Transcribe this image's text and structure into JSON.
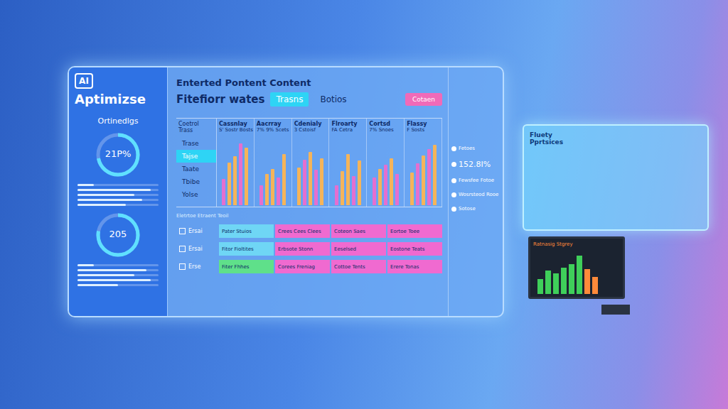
{
  "sidebar": {
    "logo": "AI",
    "title": "Aptimizse",
    "subtitle": "Ortinedlgs",
    "gauges": [
      {
        "reading": "21P%",
        "level": 0.72
      },
      {
        "reading": "205",
        "level": 0.78
      }
    ],
    "meters_top": [
      {
        "level": 0.2
      },
      {
        "level": 0.9
      },
      {
        "level": 0.7
      },
      {
        "level": 0.8
      },
      {
        "level": 0.6
      }
    ],
    "meters_bottom": [
      {
        "level": 0.2
      },
      {
        "level": 0.85
      },
      {
        "level": 0.7
      },
      {
        "level": 0.9
      },
      {
        "level": 0.5
      }
    ]
  },
  "header": {
    "title": "Enterted Pontent Content",
    "subtitle": "Fitefiorr wates",
    "tabs": [
      {
        "label": "Trasns",
        "selected": true
      },
      {
        "label": "Botios",
        "selected": false
      }
    ],
    "button": "Cotaen"
  },
  "chart": {
    "label_header": "Coetrol Trass",
    "row_labels": [
      {
        "label": "Trase",
        "selected": false
      },
      {
        "label": "Tajse",
        "selected": true
      },
      {
        "label": "Taate",
        "selected": false
      },
      {
        "label": "Tbibe",
        "selected": false
      },
      {
        "label": "Yolse",
        "selected": false
      }
    ],
    "groups": [
      {
        "label": "Cassnlay",
        "sub": "S' Sostr Bosts",
        "bars": [
          {
            "value": 40,
            "color": "#e46fd0"
          },
          {
            "value": 65,
            "color": "#f5b45a"
          },
          {
            "value": 75,
            "color": "#f5b45a"
          },
          {
            "value": 95,
            "color": "#e46fd0"
          },
          {
            "value": 88,
            "color": "#f5b45a"
          }
        ]
      },
      {
        "label": "Aacrray",
        "sub": "7% 9% Scets",
        "bars": [
          {
            "value": 30,
            "color": "#e46fd0"
          },
          {
            "value": 48,
            "color": "#f5b45a"
          },
          {
            "value": 55,
            "color": "#f5b45a"
          },
          {
            "value": 42,
            "color": "#e46fd0"
          },
          {
            "value": 78,
            "color": "#f5b45a"
          }
        ]
      },
      {
        "label": "Cdenialy",
        "sub": "3 Cstoisf",
        "bars": [
          {
            "value": 58,
            "color": "#f5b45a"
          },
          {
            "value": 70,
            "color": "#e46fd0"
          },
          {
            "value": 82,
            "color": "#f5b45a"
          },
          {
            "value": 54,
            "color": "#e46fd0"
          },
          {
            "value": 72,
            "color": "#f5b45a"
          }
        ]
      },
      {
        "label": "Flroarty",
        "sub": "FA Cetra",
        "bars": [
          {
            "value": 30,
            "color": "#e46fd0"
          },
          {
            "value": 52,
            "color": "#f5b45a"
          },
          {
            "value": 78,
            "color": "#f5b45a"
          },
          {
            "value": 45,
            "color": "#e46fd0"
          },
          {
            "value": 68,
            "color": "#f5b45a"
          }
        ]
      },
      {
        "label": "Cortsd",
        "sub": "7% Snoes",
        "bars": [
          {
            "value": 42,
            "color": "#e46fd0"
          },
          {
            "value": 55,
            "color": "#f5b45a"
          },
          {
            "value": 62,
            "color": "#e46fd0"
          },
          {
            "value": 72,
            "color": "#f5b45a"
          },
          {
            "value": 48,
            "color": "#e46fd0"
          }
        ]
      },
      {
        "label": "Flassy",
        "sub": "F Sosts",
        "bars": [
          {
            "value": 50,
            "color": "#f5b45a"
          },
          {
            "value": 64,
            "color": "#e46fd0"
          },
          {
            "value": 76,
            "color": "#f5b45a"
          },
          {
            "value": 86,
            "color": "#e46fd0"
          },
          {
            "value": 92,
            "color": "#f5b45a"
          }
        ]
      }
    ]
  },
  "table": {
    "header": "Eletrtoe Etraent Teoil",
    "rows": [
      {
        "label": "Ersai",
        "cells": [
          {
            "text": "Pater Stuios",
            "color": "#6fd6f5"
          },
          {
            "text": "Crees Cees Clees",
            "color": "#f06ad0"
          },
          {
            "text": "Coteon Saes",
            "color": "#f06ad0"
          },
          {
            "text": "Eortoe Toee",
            "color": "#f06ad0"
          }
        ]
      },
      {
        "label": "Ersai",
        "cells": [
          {
            "text": "Fitor Fioltites",
            "color": "#6fd6f5"
          },
          {
            "text": "Erbsote Stonn",
            "color": "#f06ad0"
          },
          {
            "text": "Eeselsed",
            "color": "#f06ad0"
          },
          {
            "text": "Eostone Teats",
            "color": "#f06ad0"
          }
        ]
      },
      {
        "label": "Erse",
        "cells": [
          {
            "text": "Fiter Fhhes",
            "color": "#5fe08a"
          },
          {
            "text": "Corees Freniag",
            "color": "#f06ad0"
          },
          {
            "text": "Cottoe Tents",
            "color": "#f06ad0"
          },
          {
            "text": "Erere Tonas",
            "color": "#f06ad0"
          }
        ]
      }
    ]
  },
  "right_list": [
    {
      "text": "Fetoes",
      "kind": "small"
    },
    {
      "text": "152.8I%",
      "kind": "big"
    },
    {
      "text": "Fewsfee Fotoe",
      "kind": "small"
    },
    {
      "text": "Wosrsteod Rooe",
      "kind": "small"
    },
    {
      "text": "Sotose",
      "kind": "small"
    }
  ],
  "holo_panel": {
    "title": "Fluety Pprtsices"
  },
  "monitor": {
    "title": "Ratnasig Stgrey",
    "bars": [
      {
        "value": 35,
        "color": "#3fcf5a"
      },
      {
        "value": 55,
        "color": "#3fcf5a"
      },
      {
        "value": 48,
        "color": "#3fcf5a"
      },
      {
        "value": 62,
        "color": "#3fcf5a"
      },
      {
        "value": 70,
        "color": "#3fcf5a"
      },
      {
        "value": 90,
        "color": "#3fcf5a"
      },
      {
        "value": 58,
        "color": "#ff8a3a"
      },
      {
        "value": 40,
        "color": "#ff8a3a"
      }
    ]
  }
}
